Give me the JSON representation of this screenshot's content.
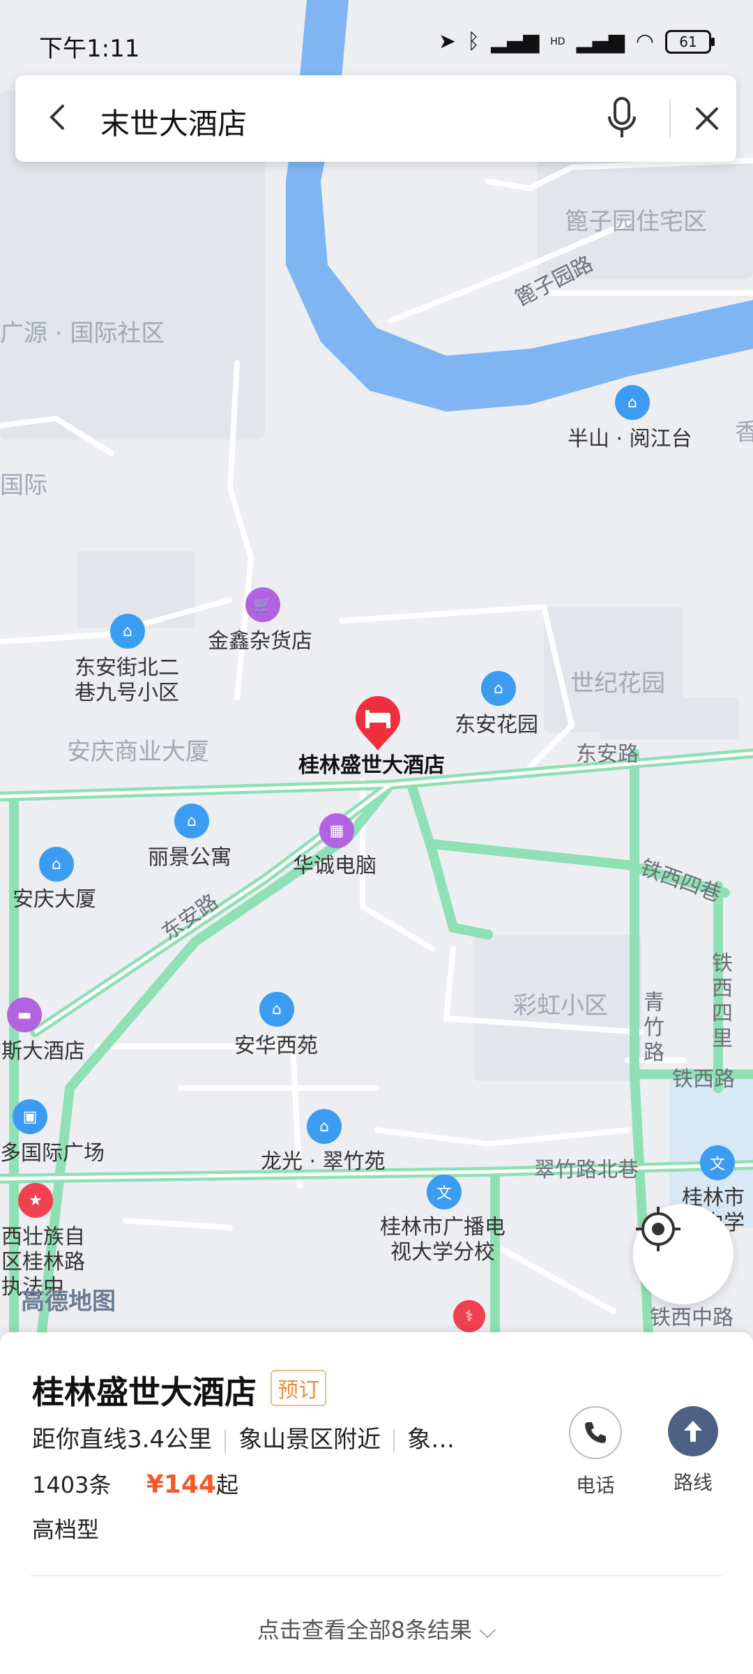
{
  "status_bar": {
    "time": "下午1:11",
    "battery": "61",
    "hd": "HD"
  },
  "search": {
    "query": "末世大酒店"
  },
  "map": {
    "area_labels": [
      "篦子园住宅区",
      "广源 · 国际社区",
      "国际",
      "世纪花园",
      "安庆商业大厦",
      "彩虹小区"
    ],
    "road_labels": [
      "篦子园路",
      "东安路",
      "东安路",
      "铁西四巷",
      "铁西四里",
      "青竹路",
      "铁西路",
      "翠竹路北巷",
      "铁西中路"
    ],
    "pois": [
      {
        "name": "半山 · 阅江台",
        "color": "blue"
      },
      {
        "name": "金鑫杂货店",
        "color": "purple"
      },
      {
        "name": "东安街北二巷九号小区",
        "color": "blue"
      },
      {
        "name": "东安花园",
        "color": "blue"
      },
      {
        "name": "丽景公寓",
        "color": "blue"
      },
      {
        "name": "华诚电脑",
        "color": "purple"
      },
      {
        "name": "安庆大厦",
        "color": "blue"
      },
      {
        "name": "斯大酒店",
        "color": "purple"
      },
      {
        "name": "安华西苑",
        "color": "blue"
      },
      {
        "name": "多国际广场",
        "color": "blue"
      },
      {
        "name": "龙光 · 翠竹苑",
        "color": "blue"
      },
      {
        "name": "桂林市广播电视大学分校",
        "color": "blue"
      },
      {
        "name": "西壮族自区桂林路执法中",
        "color": "red"
      },
      {
        "name": "桂林市第中学",
        "color": "blue"
      },
      {
        "name": "香",
        "color": "blue"
      }
    ],
    "selected_marker": "桂林盛世大酒店",
    "watermark": "高德地图"
  },
  "place": {
    "name": "桂林盛世大酒店",
    "tag": "预订",
    "distance": "距你直线3.4公里",
    "area": "象山景区附近",
    "extra": "象…",
    "reviews": "1403条",
    "price_symbol": "¥",
    "price": "144",
    "price_suffix": "起",
    "category": "高档型",
    "actions": {
      "phone": "电话",
      "route": "路线"
    },
    "more": "点击查看全部8条结果"
  },
  "colors": {
    "river": "#7fb5f2",
    "road": "#8fe0b5",
    "accent": "#ef4150",
    "route": "#4c6185"
  }
}
